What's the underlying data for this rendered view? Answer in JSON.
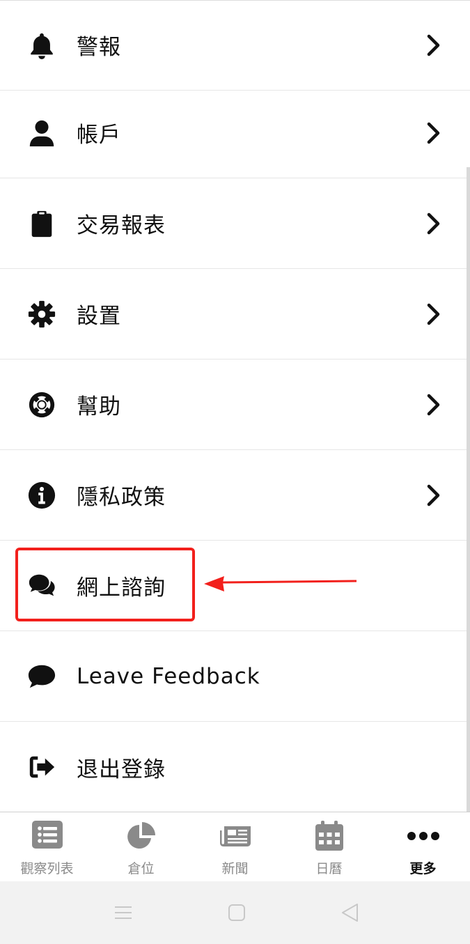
{
  "menu": {
    "items": [
      {
        "label": "警報",
        "icon": "bell-icon",
        "has_chevron": true
      },
      {
        "label": "帳戶",
        "icon": "user-icon",
        "has_chevron": true
      },
      {
        "label": "交易報表",
        "icon": "clipboard-icon",
        "has_chevron": true
      },
      {
        "label": "設置",
        "icon": "gear-icon",
        "has_chevron": true
      },
      {
        "label": "幫助",
        "icon": "lifebuoy-icon",
        "has_chevron": true
      },
      {
        "label": "隱私政策",
        "icon": "info-icon",
        "has_chevron": true
      },
      {
        "label": "網上諮詢",
        "icon": "chat-bubbles-icon",
        "has_chevron": false
      },
      {
        "label": "Leave Feedback",
        "icon": "comment-icon",
        "has_chevron": false
      },
      {
        "label": "退出登錄",
        "icon": "sign-out-icon",
        "has_chevron": false
      }
    ]
  },
  "annotation": {
    "color": "#f2201c",
    "target": "網上諮詢"
  },
  "tabbar": {
    "tabs": [
      {
        "label": "觀察列表",
        "icon": "list-icon",
        "active": false
      },
      {
        "label": "倉位",
        "icon": "pie-chart-icon",
        "active": false
      },
      {
        "label": "新聞",
        "icon": "newspaper-icon",
        "active": false
      },
      {
        "label": "日曆",
        "icon": "calendar-icon",
        "active": false
      },
      {
        "label": "更多",
        "icon": "more-dots-icon",
        "active": true
      }
    ]
  },
  "system_nav": [
    "menu-icon",
    "home-square-icon",
    "back-triangle-icon"
  ]
}
